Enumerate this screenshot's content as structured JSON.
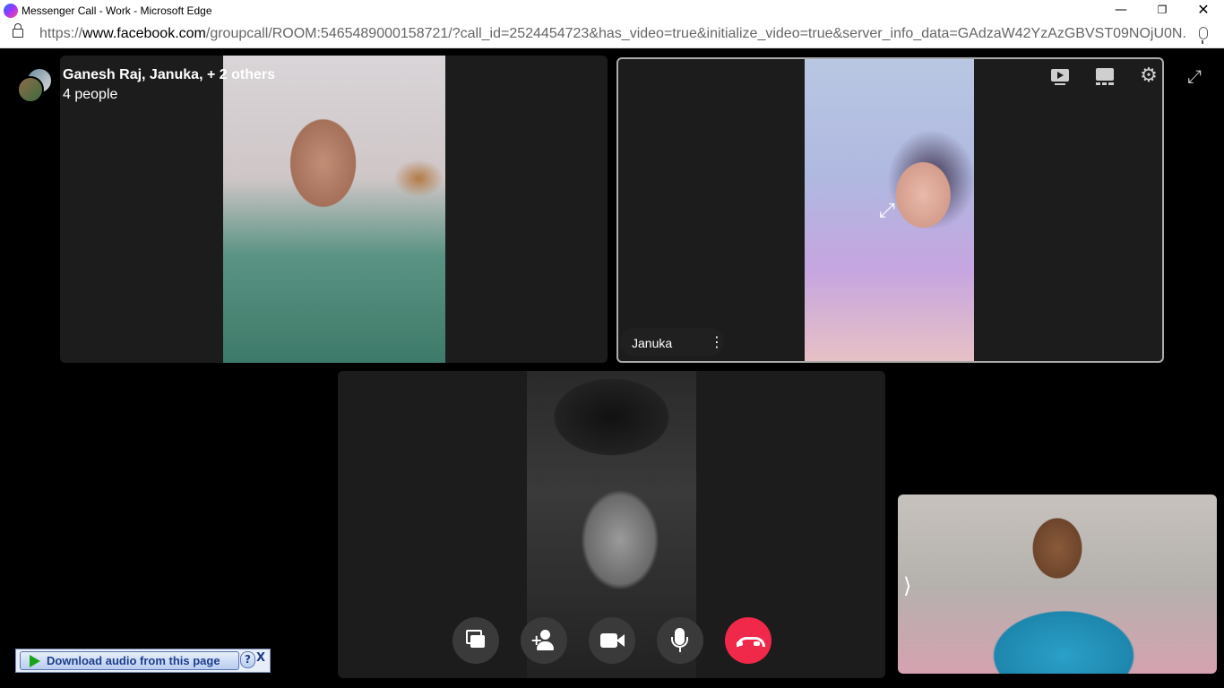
{
  "window": {
    "title": "Messenger Call - Work - Microsoft Edge",
    "min_glyph": "—",
    "max_glyph": "❐",
    "close_glyph": "✕"
  },
  "addressbar": {
    "url_prefix": "https://",
    "url_host": "www.facebook.com",
    "url_path": "/groupcall/ROOM:5465489000158721/?call_id=2524454723&has_video=true&initialize_video=true&server_info_data=GAdzaW42YzAzGBVST09NOjU0N..."
  },
  "call": {
    "title": "Ganesh Raj, Januka, + 2 others",
    "participants_count": "4 people",
    "tiles": [
      {
        "participant": "",
        "icon": "video-feed"
      },
      {
        "participant": "Januka",
        "menu_glyph": "⋮",
        "expand_glyph": "⤢",
        "active_speaker": true
      },
      {
        "participant": "",
        "icon": "video-feed"
      }
    ],
    "self_view": {
      "chevron": "⟩"
    }
  },
  "top_icons": {
    "settings_glyph": "⚙",
    "fullscreen_glyph": "⤢",
    "names": [
      "present-icon",
      "layout-icon",
      "settings-icon",
      "fullscreen-icon"
    ]
  },
  "controls": {
    "items": [
      "share-screen",
      "add-person",
      "video",
      "microphone",
      "end-call"
    ],
    "add_plus": "+",
    "end_color": "#f02849",
    "button_color": "#3a3a3a"
  },
  "download_bar": {
    "label": "Download audio from this page",
    "help": "?",
    "close": "X"
  }
}
